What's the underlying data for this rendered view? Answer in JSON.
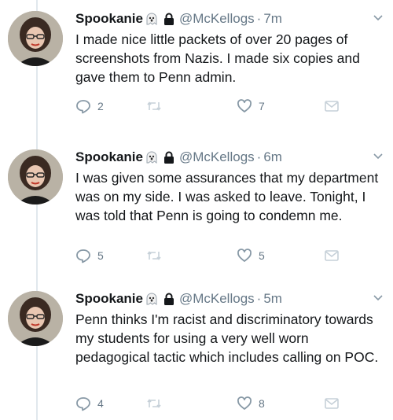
{
  "tweets": [
    {
      "name": "Spookanie",
      "handle": "@McKellogs",
      "separator": "·",
      "time": "7m",
      "text": "I made nice little packets of over 20 pages of screenshots from Nazis. I made six copies and gave them to Penn admin.",
      "replies": "2",
      "retweets": "",
      "likes": "7"
    },
    {
      "name": "Spookanie",
      "handle": "@McKellogs",
      "separator": "·",
      "time": "6m",
      "text": "I was given some assurances that my department was on my side. I was asked to leave. Tonight, I was told that Penn is going to condemn me.",
      "replies": "5",
      "retweets": "",
      "likes": "5"
    },
    {
      "name": "Spookanie",
      "handle": "@McKellogs",
      "separator": "·",
      "time": "5m",
      "text": "Penn thinks I'm racist and discriminatory towards my students for using a very well worn pedagogical tactic which includes calling on POC.",
      "replies": "4",
      "retweets": "",
      "likes": "8"
    }
  ],
  "icons": {
    "name_emoji": "ghost-icon",
    "protected": "lock-icon",
    "menu": "chevron-down-icon",
    "reply": "reply-icon",
    "retweet": "retweet-icon",
    "like": "heart-icon",
    "dm": "envelope-icon"
  },
  "colors": {
    "text": "#14171a",
    "muted": "#657786",
    "thread_line": "#e1e8ed"
  }
}
